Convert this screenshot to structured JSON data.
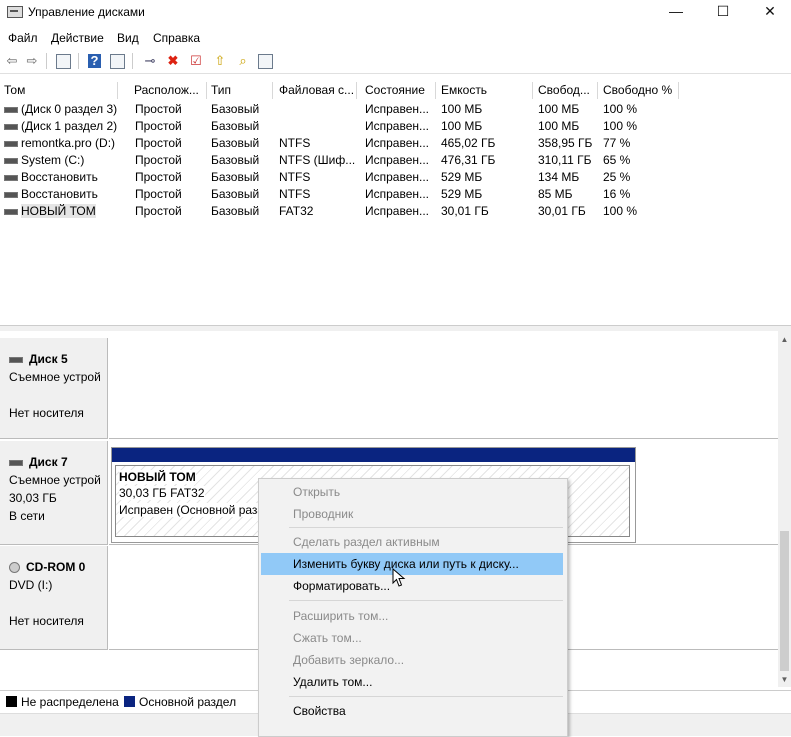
{
  "window": {
    "title": "Управление дисками",
    "minimize": "—",
    "maximize": "☐",
    "close": "✕"
  },
  "menu": [
    "Файл",
    "Действие",
    "Вид",
    "Справка"
  ],
  "toolbar": {
    "icons": [
      "back-arrow-icon",
      "forward-arrow-icon",
      "properties-icon",
      "help-icon",
      "console-tree-icon",
      "connect-disk-icon",
      "delete-icon",
      "check-icon",
      "up-folder-icon",
      "search-folder-icon",
      "list-icon"
    ]
  },
  "volumes": {
    "headers": [
      "Том",
      "Располож...",
      "Тип",
      "Файловая с...",
      "Состояние",
      "Емкость",
      "Свобод...",
      "Свободно %"
    ],
    "rows": [
      [
        "(Диск 0 раздел 3)",
        "Простой",
        "Базовый",
        "",
        "Исправен...",
        "100 МБ",
        "100 МБ",
        "100 %"
      ],
      [
        "(Диск 1 раздел 2)",
        "Простой",
        "Базовый",
        "",
        "Исправен...",
        "100 МБ",
        "100 МБ",
        "100 %"
      ],
      [
        "remontka.pro (D:)",
        "Простой",
        "Базовый",
        "NTFS",
        "Исправен...",
        "465,02 ГБ",
        "358,95 ГБ",
        "77 %"
      ],
      [
        "System (C:)",
        "Простой",
        "Базовый",
        "NTFS (Шиф...",
        "Исправен...",
        "476,31 ГБ",
        "310,11 ГБ",
        "65 %"
      ],
      [
        "Восстановить",
        "Простой",
        "Базовый",
        "NTFS",
        "Исправен...",
        "529 МБ",
        "134 МБ",
        "25 %"
      ],
      [
        "Восстановить",
        "Простой",
        "Базовый",
        "NTFS",
        "Исправен...",
        "529 МБ",
        "85 МБ",
        "16 %"
      ],
      [
        "НОВЫЙ ТОМ",
        "Простой",
        "Базовый",
        "FAT32",
        "Исправен...",
        "30,01 ГБ",
        "30,01 ГБ",
        "100 %"
      ]
    ]
  },
  "disks": [
    {
      "name": "Диск 5",
      "line1": "Съемное устрой",
      "line2": "",
      "line3": "Нет носителя"
    },
    {
      "name": "Диск 7",
      "line1": "Съемное устрой",
      "line2": "30,03 ГБ",
      "line3": "В сети"
    },
    {
      "name": "CD-ROM 0",
      "line1": "DVD (I:)",
      "line2": "",
      "line3": "Нет носителя"
    }
  ],
  "partition": {
    "name": "НОВЫЙ ТОМ",
    "size": "30,03 ГБ FAT32",
    "status": "Исправен (Основной раз"
  },
  "legend": {
    "unallocated": "Не распределена",
    "primary": "Основной раздел",
    "unallocated_color": "#000000",
    "primary_color": "#0a2480"
  },
  "context_menu": {
    "items": [
      {
        "label": "Открыть",
        "disabled": true
      },
      {
        "label": "Проводник",
        "disabled": true
      },
      {
        "label": "Сделать раздел активным",
        "disabled": true
      },
      {
        "label": "Изменить букву диска или путь к диску...",
        "disabled": false,
        "highlighted": true
      },
      {
        "label": "Форматировать...",
        "disabled": false
      },
      {
        "label": "Расширить том...",
        "disabled": true
      },
      {
        "label": "Сжать том...",
        "disabled": true
      },
      {
        "label": "Добавить зеркало...",
        "disabled": true
      },
      {
        "label": "Удалить том...",
        "disabled": false
      },
      {
        "label": "Свойства",
        "disabled": false
      }
    ],
    "highlight_color": "#91c9f7"
  }
}
